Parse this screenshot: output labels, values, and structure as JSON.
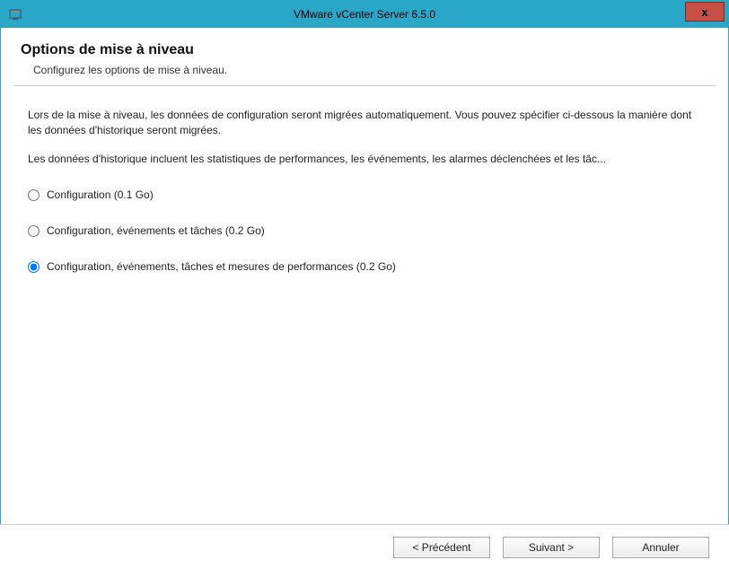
{
  "window": {
    "title": "VMware vCenter Server 6.5.0"
  },
  "header": {
    "title": "Options de mise à niveau",
    "subtitle": "Configurez les options de mise à niveau."
  },
  "body": {
    "para1": "Lors de la mise à niveau, les données de configuration seront migrées automatiquement. Vous pouvez spécifier ci-dessous la manière dont les données d'historique seront migrées.",
    "para2": "Les données d'historique incluent les statistiques de performances, les événements, les alarmes déclenchées et les tâc..."
  },
  "options": [
    {
      "label": "Configuration (0.1 Go)",
      "selected": false
    },
    {
      "label": "Configuration, événements et tâches (0.2 Go)",
      "selected": false
    },
    {
      "label": "Configuration, événements, tâches et mesures de performances (0.2 Go)",
      "selected": true
    }
  ],
  "footer": {
    "back": "< Précédent",
    "next": "Suivant >",
    "cancel": "Annuler"
  }
}
